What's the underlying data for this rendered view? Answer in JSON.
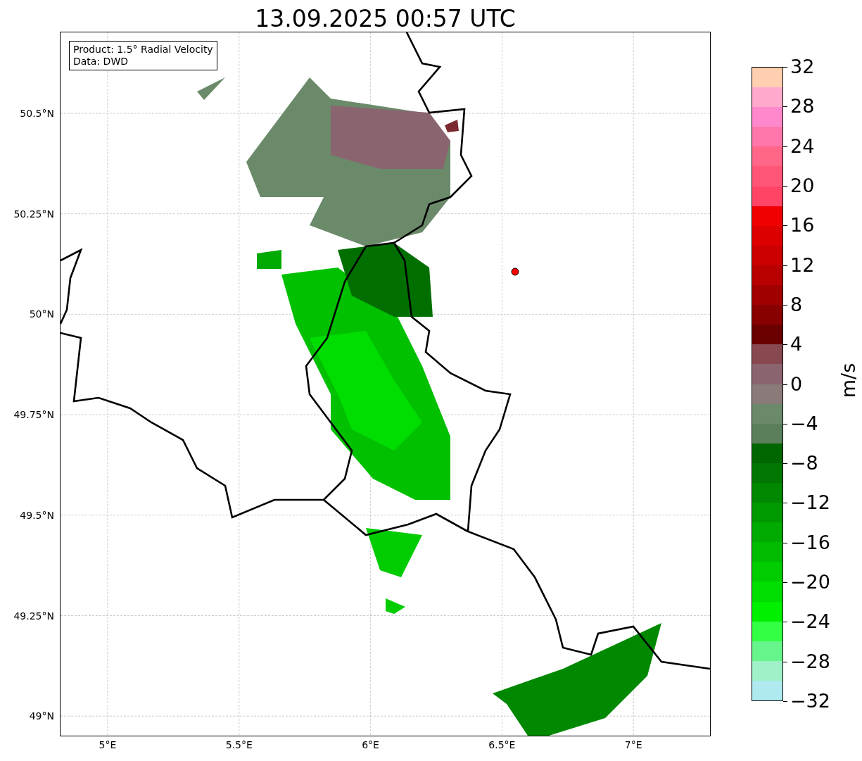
{
  "title": "13.09.2025 00:57 UTC",
  "info_box": [
    "Product: 1.5° Radial Velocity",
    "Data: DWD"
  ],
  "lat_ticks": [
    "50.5°N",
    "50.25°N",
    "50°N",
    "49.75°N",
    "49.5°N",
    "49.25°N",
    "49°N"
  ],
  "lon_ticks": [
    "5°E",
    "5.5°E",
    "6°E",
    "6.5°E",
    "7°E"
  ],
  "colorbar": {
    "label": "m/s",
    "ticks": [
      "32",
      "28",
      "24",
      "20",
      "16",
      "12",
      "8",
      "4",
      "0",
      "−4",
      "−8",
      "−12",
      "−16",
      "−20",
      "−24",
      "−28",
      "−32"
    ],
    "bins": [
      {
        "color": "#ffcfb0"
      },
      {
        "color": "#ffaacc"
      },
      {
        "color": "#ff88cc"
      },
      {
        "color": "#ff77aa"
      },
      {
        "color": "#ff6688"
      },
      {
        "color": "#ff5577"
      },
      {
        "color": "#ff4466"
      },
      {
        "color": "#f00000"
      },
      {
        "color": "#dd0000"
      },
      {
        "color": "#cc0000"
      },
      {
        "color": "#b80000"
      },
      {
        "color": "#a00000"
      },
      {
        "color": "#880000"
      },
      {
        "color": "#6a0000"
      },
      {
        "color": "#884850"
      },
      {
        "color": "#8a6570"
      },
      {
        "color": "#8a7a7a"
      },
      {
        "color": "#6a8a6a"
      },
      {
        "color": "#5a7f5a"
      },
      {
        "color": "#006600"
      },
      {
        "color": "#007700"
      },
      {
        "color": "#008800"
      },
      {
        "color": "#009900"
      },
      {
        "color": "#00aa00"
      },
      {
        "color": "#00bb00"
      },
      {
        "color": "#00cc00"
      },
      {
        "color": "#00dd00"
      },
      {
        "color": "#00f000"
      },
      {
        "color": "#33ff44"
      },
      {
        "color": "#66f58a"
      },
      {
        "color": "#a0f0c8"
      },
      {
        "color": "#aeeaf0"
      }
    ]
  }
}
